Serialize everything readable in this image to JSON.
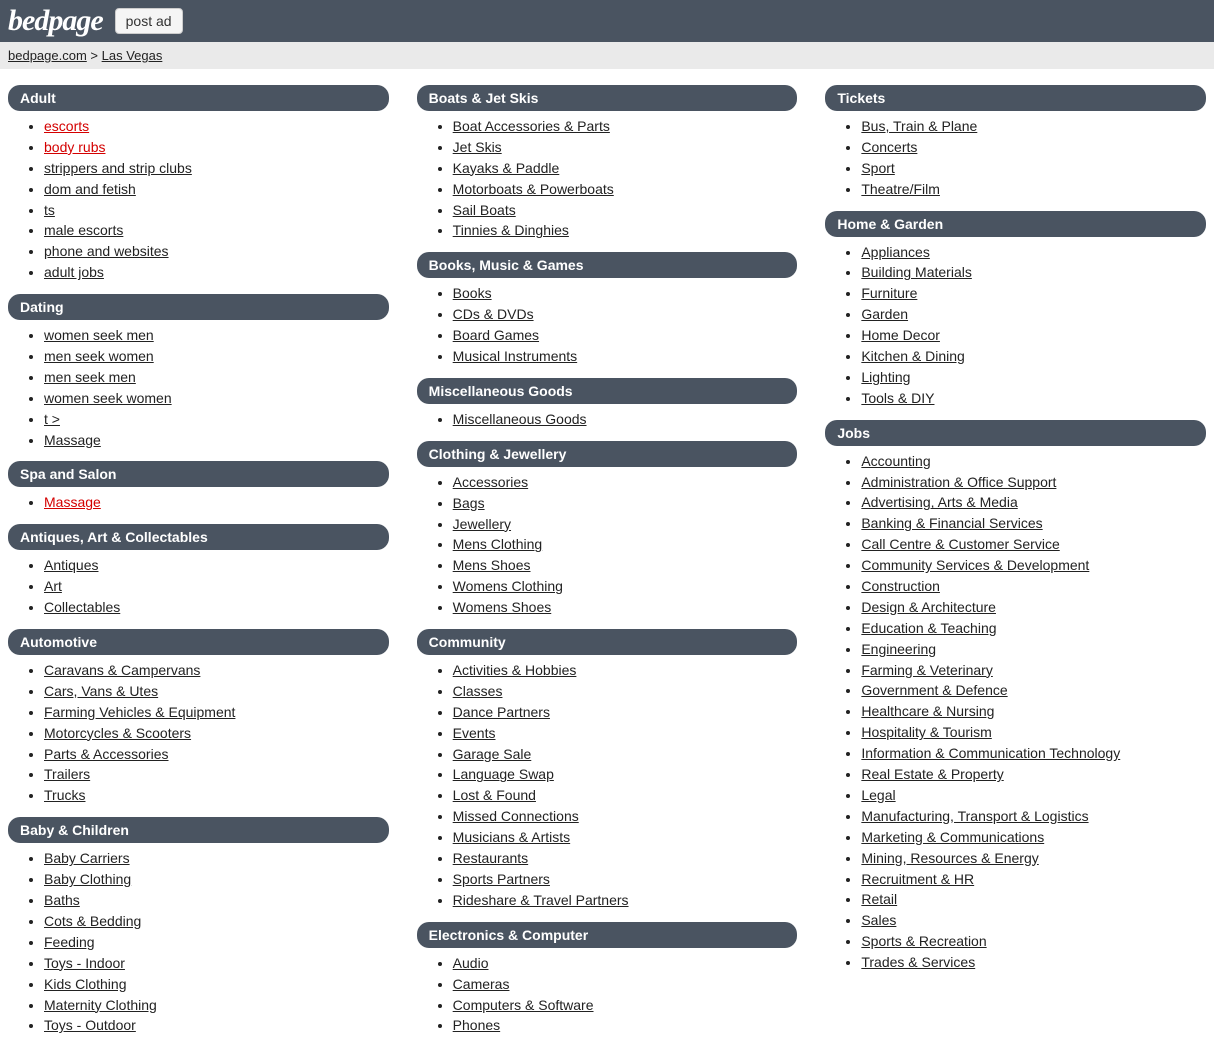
{
  "header": {
    "logo": "bedpage",
    "post_ad": "post ad"
  },
  "breadcrumb": {
    "home": "bedpage.com",
    "sep": ">",
    "location": "Las Vegas"
  },
  "columns": [
    [
      {
        "title": "Adult",
        "items": [
          {
            "label": "escorts",
            "hot": true
          },
          {
            "label": "body rubs",
            "hot": true
          },
          {
            "label": "strippers and strip clubs"
          },
          {
            "label": "dom and fetish"
          },
          {
            "label": "ts"
          },
          {
            "label": "male escorts"
          },
          {
            "label": "phone and websites"
          },
          {
            "label": "adult jobs"
          }
        ]
      },
      {
        "title": "Dating",
        "items": [
          {
            "label": "women seek men"
          },
          {
            "label": "men seek women"
          },
          {
            "label": "men seek men"
          },
          {
            "label": "women seek women"
          },
          {
            "label": "t >"
          },
          {
            "label": "Massage"
          }
        ]
      },
      {
        "title": "Spa and Salon",
        "items": [
          {
            "label": "Massage",
            "hot": true
          }
        ]
      },
      {
        "title": "Antiques, Art & Collectables",
        "items": [
          {
            "label": "Antiques"
          },
          {
            "label": "Art"
          },
          {
            "label": "Collectables"
          }
        ]
      },
      {
        "title": "Automotive",
        "items": [
          {
            "label": "Caravans & Campervans"
          },
          {
            "label": "Cars, Vans & Utes"
          },
          {
            "label": "Farming Vehicles & Equipment"
          },
          {
            "label": "Motorcycles & Scooters"
          },
          {
            "label": "Parts & Accessories"
          },
          {
            "label": "Trailers"
          },
          {
            "label": "Trucks"
          }
        ]
      },
      {
        "title": "Baby & Children",
        "items": [
          {
            "label": "Baby Carriers"
          },
          {
            "label": "Baby Clothing"
          },
          {
            "label": "Baths"
          },
          {
            "label": "Cots & Bedding"
          },
          {
            "label": "Feeding"
          },
          {
            "label": "Toys - Indoor"
          },
          {
            "label": "Kids Clothing"
          },
          {
            "label": "Maternity Clothing"
          },
          {
            "label": "Toys - Outdoor"
          }
        ]
      }
    ],
    [
      {
        "title": "Boats & Jet Skis",
        "items": [
          {
            "label": "Boat Accessories & Parts"
          },
          {
            "label": "Jet Skis"
          },
          {
            "label": "Kayaks & Paddle"
          },
          {
            "label": "Motorboats & Powerboats"
          },
          {
            "label": "Sail Boats"
          },
          {
            "label": "Tinnies & Dinghies"
          }
        ]
      },
      {
        "title": "Books, Music & Games",
        "items": [
          {
            "label": "Books"
          },
          {
            "label": "CDs & DVDs"
          },
          {
            "label": "Board Games"
          },
          {
            "label": "Musical Instruments"
          }
        ]
      },
      {
        "title": "Miscellaneous Goods",
        "items": [
          {
            "label": "Miscellaneous Goods"
          }
        ]
      },
      {
        "title": "Clothing & Jewellery",
        "items": [
          {
            "label": "Accessories"
          },
          {
            "label": "Bags"
          },
          {
            "label": "Jewellery"
          },
          {
            "label": "Mens Clothing"
          },
          {
            "label": "Mens Shoes"
          },
          {
            "label": "Womens Clothing"
          },
          {
            "label": "Womens Shoes"
          }
        ]
      },
      {
        "title": "Community",
        "items": [
          {
            "label": "Activities & Hobbies"
          },
          {
            "label": "Classes"
          },
          {
            "label": "Dance Partners"
          },
          {
            "label": "Events"
          },
          {
            "label": "Garage Sale"
          },
          {
            "label": "Language Swap"
          },
          {
            "label": "Lost & Found"
          },
          {
            "label": "Missed Connections"
          },
          {
            "label": "Musicians & Artists"
          },
          {
            "label": "Restaurants"
          },
          {
            "label": "Sports Partners"
          },
          {
            "label": "Rideshare & Travel Partners"
          }
        ]
      },
      {
        "title": "Electronics & Computer",
        "items": [
          {
            "label": "Audio"
          },
          {
            "label": "Cameras"
          },
          {
            "label": "Computers & Software"
          },
          {
            "label": "Phones"
          }
        ]
      }
    ],
    [
      {
        "title": "Tickets",
        "items": [
          {
            "label": "Bus, Train & Plane"
          },
          {
            "label": "Concerts"
          },
          {
            "label": "Sport"
          },
          {
            "label": "Theatre/Film"
          }
        ]
      },
      {
        "title": "Home & Garden",
        "items": [
          {
            "label": "Appliances"
          },
          {
            "label": "Building Materials"
          },
          {
            "label": "Furniture"
          },
          {
            "label": "Garden"
          },
          {
            "label": "Home Decor"
          },
          {
            "label": "Kitchen & Dining"
          },
          {
            "label": "Lighting"
          },
          {
            "label": "Tools & DIY"
          }
        ]
      },
      {
        "title": "Jobs",
        "items": [
          {
            "label": "Accounting"
          },
          {
            "label": "Administration & Office Support"
          },
          {
            "label": "Advertising, Arts & Media"
          },
          {
            "label": "Banking & Financial Services"
          },
          {
            "label": "Call Centre & Customer Service"
          },
          {
            "label": "Community Services & Development"
          },
          {
            "label": "Construction"
          },
          {
            "label": "Design & Architecture"
          },
          {
            "label": "Education & Teaching"
          },
          {
            "label": "Engineering"
          },
          {
            "label": "Farming & Veterinary"
          },
          {
            "label": "Government & Defence"
          },
          {
            "label": "Healthcare & Nursing"
          },
          {
            "label": "Hospitality & Tourism"
          },
          {
            "label": "Information & Communication Technology"
          },
          {
            "label": "Real Estate & Property"
          },
          {
            "label": "Legal"
          },
          {
            "label": "Manufacturing, Transport & Logistics"
          },
          {
            "label": "Marketing & Communications"
          },
          {
            "label": "Mining, Resources & Energy"
          },
          {
            "label": "Recruitment & HR"
          },
          {
            "label": "Retail"
          },
          {
            "label": "Sales"
          },
          {
            "label": "Sports & Recreation"
          },
          {
            "label": "Trades & Services"
          }
        ]
      }
    ]
  ]
}
